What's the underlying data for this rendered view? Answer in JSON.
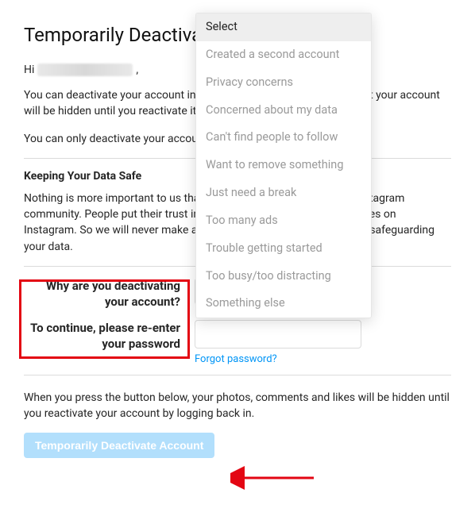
{
  "title": "Temporarily Deactivate Your Account",
  "greetingPrefix": "Hi",
  "intro1": "You can deactivate your account instead of deleting it. This means that your account will be hidden until you reactivate it by logging back in.",
  "intro2": "You can only deactivate your account once a week.",
  "section": {
    "title": "Keeping Your Data Safe",
    "body": "Nothing is more important to us than the safety and security of the Instagram community. People put their trust in us by sharing moments of their lives on Instagram. So we will never make any compromises when it comes to safeguarding your data."
  },
  "form": {
    "reasonLabel": "Why are you deactivating your account?",
    "passwordLabel": "To continue, please re-enter your password",
    "selectPlaceholder": "Select",
    "forgot": "Forgot password?"
  },
  "dropdown": {
    "options": [
      "Select",
      "Created a second account",
      "Privacy concerns",
      "Concerned about my data",
      "Can't find people to follow",
      "Want to remove something",
      "Just need a break",
      "Too many ads",
      "Trouble getting started",
      "Too busy/too distracting",
      "Something else"
    ]
  },
  "footer": {
    "note": "When you press the button below, your photos, comments and likes will be hidden until you reactivate your account by logging back in.",
    "button": "Temporarily Deactivate Account"
  }
}
